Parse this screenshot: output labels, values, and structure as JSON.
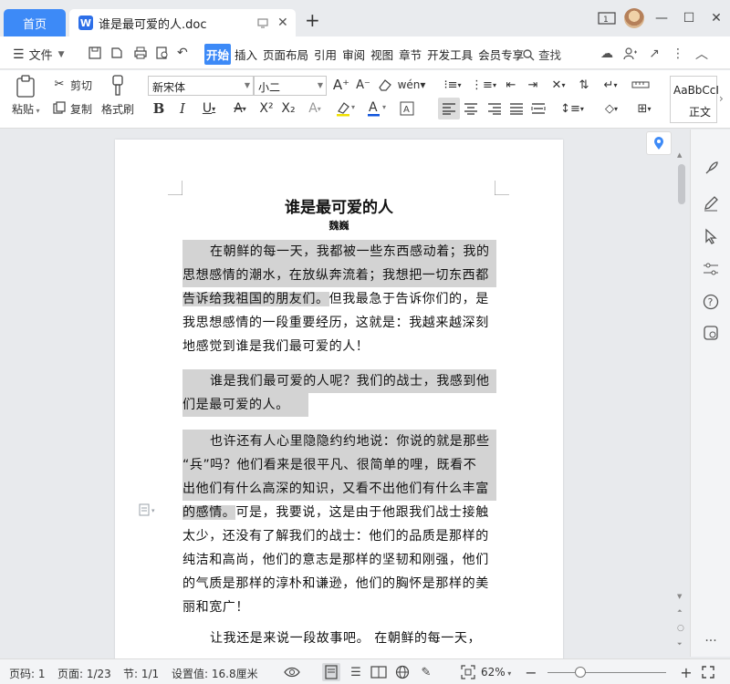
{
  "tabs": {
    "home": "首页",
    "document": "谁是最可爱的人.doc"
  },
  "ribbon": {
    "file_menu": "文件",
    "tabs": [
      "开始",
      "插入",
      "页面布局",
      "引用",
      "审阅",
      "视图",
      "章节",
      "开发工具",
      "会员专享"
    ],
    "active_tab": "开始",
    "search": "查找"
  },
  "toolbar": {
    "paste": "粘贴",
    "cut": "剪切",
    "copy": "复制",
    "format_painter": "格式刷",
    "font_name": "新宋体",
    "font_size": "小二",
    "style_preview": "AaBbCcI",
    "style_name": "正文"
  },
  "document": {
    "title": "谁是最可爱的人",
    "author": "魏巍",
    "paragraphs": [
      {
        "lines": [
          {
            "text": "在朝鲜的每一天，我都被一些东西感动着；我的",
            "highlight": true,
            "indent": true
          },
          {
            "text": "思想感情的潮水，在放纵奔流着；我想把一切东西都",
            "highlight": true
          },
          {
            "text": "告诉给我祖国的朋友们。但我最急于告诉你们的，是",
            "highlight_part": "告诉给我祖国的朋友们。",
            "rest": "但我最急于告诉你们的，是"
          },
          {
            "text": "我思想感情的一段重要经历，这就是：我越来越深刻"
          },
          {
            "text": "地感觉到谁是我们最可爱的人！"
          }
        ]
      },
      {
        "lines": [
          {
            "text": "谁是我们最可爱的人呢？我们的战士，我感到他",
            "highlight": true,
            "indent": true
          },
          {
            "text": "们是最可爱的人。",
            "highlight": true,
            "pad_to": 138
          }
        ]
      },
      {
        "lines": [
          {
            "text": "也许还有人心里隐隐约约地说：你说的就是那些",
            "highlight": true,
            "indent": true
          },
          {
            "text": "“兵”吗？他们看来是很平凡、很简单的哩，既看不",
            "highlight": true
          },
          {
            "text": "出他们有什么高深的知识，又看不出他们有什么丰富",
            "highlight": true
          },
          {
            "text": "的感情。可是，我要说，这是由于他跟我们战士接触",
            "highlight_part": "的感情。",
            "rest": "可是，我要说，这是由于他跟我们战士接触"
          },
          {
            "text": "太少，还没有了解我们的战士：他们的品质是那样的"
          },
          {
            "text": "纯洁和高尚，他们的意志是那样的坚韧和刚强，他们"
          },
          {
            "text": "的气质是那样的淳朴和谦逊，他们的胸怀是那样的美"
          },
          {
            "text": "丽和宽广！"
          }
        ]
      },
      {
        "lines": [
          {
            "text": "让我还是来说一段故事吧。  在朝鲜的每一天，",
            "indent": true
          }
        ]
      }
    ]
  },
  "statusbar": {
    "page_num": "页码: 1",
    "pages": "页面: 1/23",
    "section": "节: 1/1",
    "setting": "设置值: 16.8厘米",
    "zoom": "62%"
  }
}
